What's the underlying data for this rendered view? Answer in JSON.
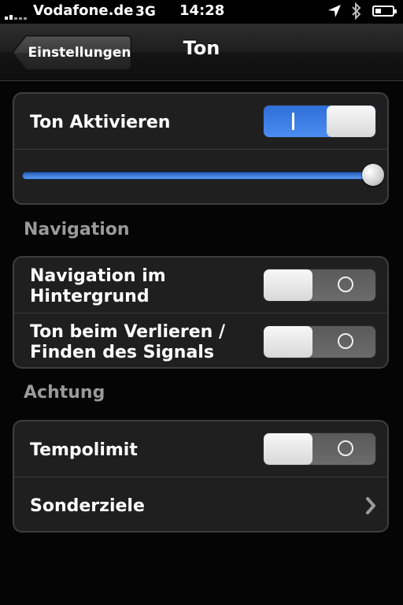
{
  "status_bar": {
    "carrier": "Vodafone.de",
    "network": "3G",
    "time": "14:28",
    "icons": [
      "signal-icon",
      "location-icon",
      "bluetooth-icon",
      "battery-icon"
    ]
  },
  "nav": {
    "back_label": "Einstellungen",
    "title": "Ton"
  },
  "sound": {
    "enable_label": "Ton Aktivieren",
    "enable_on": true,
    "switch_on_glyph": "I",
    "volume_fraction": 1.0
  },
  "navigation_section": {
    "header": "Navigation",
    "background_nav_label_line1": "Navigation im",
    "background_nav_label_line2": "Hintergrund",
    "background_nav_on": false,
    "signal_sound_label_line1": "Ton beim Verlieren /",
    "signal_sound_label_line2": "Finden des Signals",
    "signal_sound_on": false
  },
  "attention_section": {
    "header": "Achtung",
    "speed_limit_label": "Tempolimit",
    "speed_limit_on": false,
    "poi_label": "Sonderziele"
  },
  "colors": {
    "switch_on_blue": "#3a7be6",
    "section_header_gray": "#9a9a9a",
    "group_background": "#1f1f1f"
  }
}
